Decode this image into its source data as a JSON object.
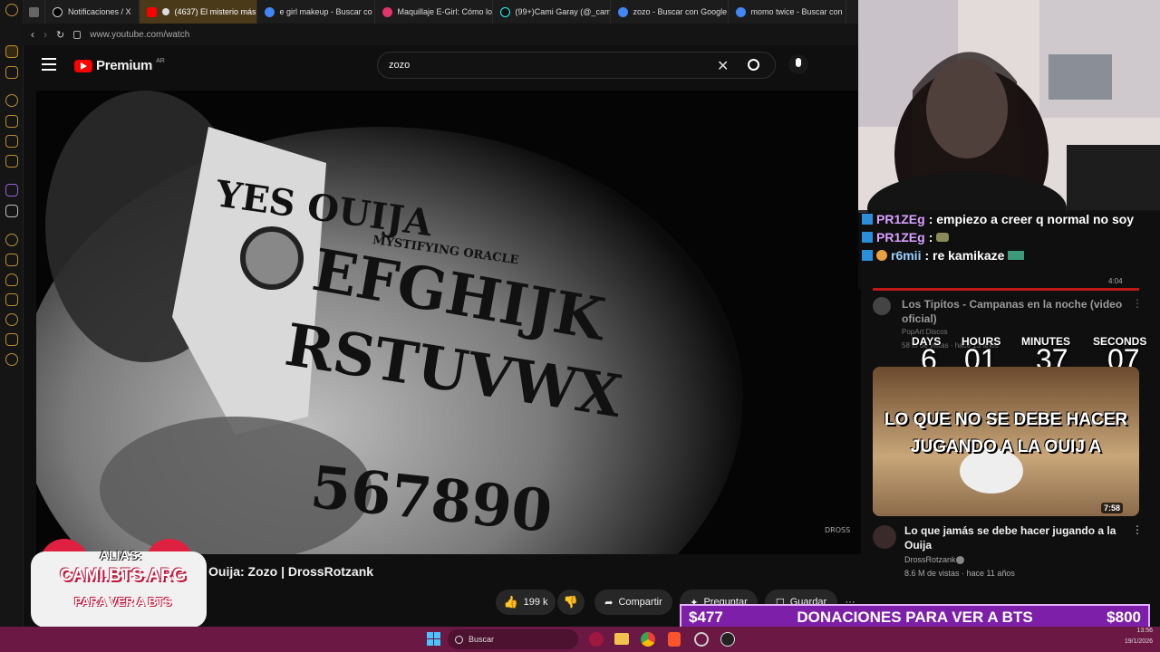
{
  "tabs": [
    {
      "label": "Notificaciones / X"
    },
    {
      "label": "(4637) El misterio más"
    },
    {
      "label": "e girl makeup - Buscar co"
    },
    {
      "label": "Maquillaje E-Girl: Cómo lo"
    },
    {
      "label": "(99+)Cami Garay (@_cam"
    },
    {
      "label": "zozo - Buscar con Google"
    },
    {
      "label": "momo twice - Buscar con"
    }
  ],
  "address": {
    "url": "www.youtube.com/watch"
  },
  "youtube": {
    "logo_text": "Premium",
    "region": "AR",
    "search_value": "zozo"
  },
  "video": {
    "title": "Ouija: Zozo | DrossRotzank",
    "likes": "199 k",
    "share_label": "Compartir",
    "ask_label": "Preguntar",
    "save_label": "Guardar",
    "board_top": "YES   OUIJA",
    "board_sub": "MYSTIFYING ORACLE",
    "board_row1": "EFGHIJK",
    "board_row2": "RSTUVWX",
    "board_row3": "567890",
    "watermark": "DROSS"
  },
  "chat": [
    {
      "user": "PR1ZEg",
      "message": ": empiezo a creer q normal no soy",
      "color": "#d8a0ff"
    },
    {
      "user": "PR1ZEg",
      "message": ":",
      "color": "#d8a0ff"
    },
    {
      "user": "r6mii",
      "message": ": re kamikaze",
      "color": "#9ad0ff"
    }
  ],
  "related": [
    {
      "title": "Los Tipitos - Campanas en la noche (video oficial)",
      "channel": "PopArt Discos",
      "meta": "58 M de vistas · hace 13 años",
      "duration": "4:04"
    },
    {
      "title": "Lo que jamás se debe hacer jugando a la Ouija",
      "channel": "DrossRotzank",
      "meta": "8.6 M de vistas · hace 11 años",
      "duration": "7:58",
      "thumb_line1": "LO QUE NO SE DEBE HACER",
      "thumb_line2": "JUGANDO A LA OUIJ A"
    }
  ],
  "timer": {
    "labels": {
      "days": "DAYS",
      "hours": "HOURS",
      "minutes": "MINUTES",
      "seconds": "SECONDS"
    },
    "values": {
      "days": "6",
      "hours": "01",
      "minutes": "37",
      "seconds": "07"
    }
  },
  "overlay": {
    "alias_label": "ALIAS:",
    "alias_value": "CAMI.BTS.ARG",
    "alias_sub": "PARA VER A BTS"
  },
  "donation": {
    "current": "$477",
    "label": "DONACIONES PARA VER A BTS",
    "goal": "$800"
  },
  "taskbar": {
    "search_label": "Buscar",
    "time": "13:56",
    "date": "19/1/2026"
  },
  "colors": {
    "taskbar": "#6b1844",
    "donation": "#7d1fa8",
    "youtube_red": "#ff0000",
    "accent": "#d8a23a"
  }
}
